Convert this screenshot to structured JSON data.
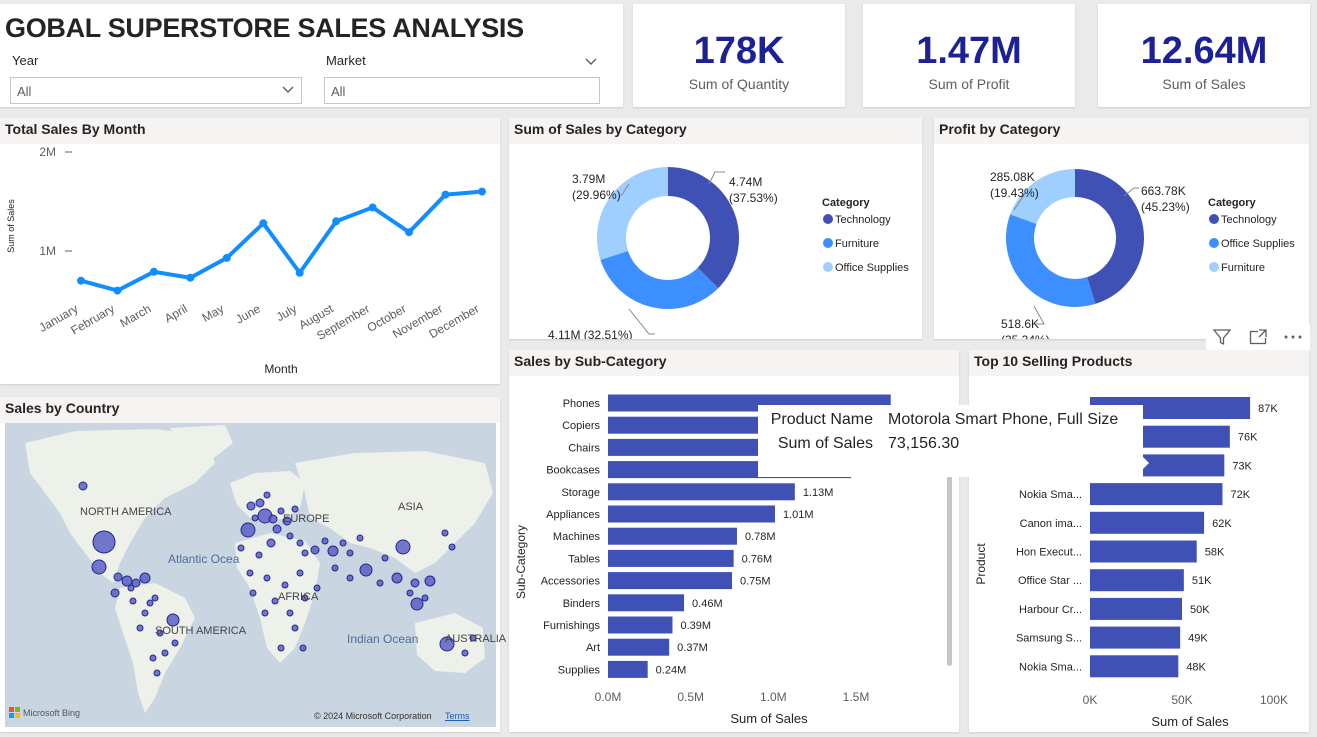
{
  "header": {
    "title": "GOBAL SUPERSTORE SALES ANALYSIS"
  },
  "filters": {
    "year": {
      "label": "Year",
      "value": "All"
    },
    "market": {
      "label": "Market",
      "value": "All"
    }
  },
  "kpis": [
    {
      "value": "178K",
      "label": "Sum of Quantity"
    },
    {
      "value": "1.47M",
      "label": "Sum of Profit"
    },
    {
      "value": "12.64M",
      "label": "Sum of Sales"
    }
  ],
  "colors": {
    "accent": "#1c2296",
    "line": "#118dff",
    "dark_blue": "#3f51b5",
    "mid_blue": "#3d8fff",
    "light_blue": "#9fcfff"
  },
  "visual_actions": [
    "filter-icon",
    "focus-mode-icon",
    "more-options-icon"
  ],
  "tooltip": {
    "product_label": "Product Name",
    "product_value": "Motorola Smart Phone, Full Size",
    "sales_label": "Sum of Sales",
    "sales_value": "73,156.30"
  },
  "map": {
    "title": "Sales by Country",
    "labels": {
      "na": "NORTH AMERICA",
      "eu": "EUROPE",
      "asia": "ASIA",
      "atlantic": "Atlantic Ocea",
      "africa": "AFRICA",
      "sa": "SOUTH AMERICA",
      "indian": "Indian Ocean",
      "aus": "AUSTRALIA"
    },
    "bing": "Microsoft Bing",
    "copyright": "© 2024 Microsoft Corporation",
    "terms": "Terms"
  },
  "chart_data": [
    {
      "type": "line",
      "title": "Total Sales By Month",
      "xlabel": "Month",
      "ylabel": "Sum of Sales",
      "categories": [
        "January",
        "February",
        "March",
        "April",
        "May",
        "June",
        "July",
        "August",
        "September",
        "October",
        "November",
        "December"
      ],
      "values": [
        0.7,
        0.6,
        0.79,
        0.73,
        0.93,
        1.28,
        0.78,
        1.3,
        1.44,
        1.19,
        1.57,
        1.6
      ],
      "yticks": [
        "1M",
        "2M"
      ],
      "ylim": [
        0,
        2.2
      ],
      "grid": false
    },
    {
      "type": "pie",
      "title": "Sum of Sales by Category",
      "legend_title": "Category",
      "legend_position": "right",
      "slices": [
        {
          "name": "Technology",
          "value": 4.74,
          "label": "4.74M",
          "percent": "(37.53%)"
        },
        {
          "name": "Furniture",
          "value": 4.11,
          "label": "4.11M (32.51%)",
          "percent": ""
        },
        {
          "name": "Office Supplies",
          "value": 3.79,
          "label": "3.79M",
          "percent": "(29.96%)"
        }
      ]
    },
    {
      "type": "pie",
      "title": "Profit by Category",
      "legend_title": "Category",
      "legend_position": "right",
      "slices": [
        {
          "name": "Technology",
          "value": 663.78,
          "label": "663.78K",
          "percent": "(45.23%)"
        },
        {
          "name": "Office Supplies",
          "value": 518.6,
          "label": "518.6K",
          "percent": "(35.34%)"
        },
        {
          "name": "Furniture",
          "value": 285.08,
          "label": "285.08K",
          "percent": "(19.43%)"
        }
      ]
    },
    {
      "type": "bar",
      "orientation": "horizontal",
      "title": "Sales by Sub-Category",
      "xlabel": "Sum of Sales",
      "ylabel": "Sub-Category",
      "categories": [
        "Phones",
        "Copiers",
        "Chairs",
        "Bookcases",
        "Storage",
        "Appliances",
        "Machines",
        "Tables",
        "Accessories",
        "Binders",
        "Furnishings",
        "Art",
        "Supplies"
      ],
      "values": [
        1.71,
        1.51,
        1.5,
        1.47,
        1.13,
        1.01,
        0.78,
        0.76,
        0.75,
        0.46,
        0.39,
        0.37,
        0.24
      ],
      "data_labels": [
        "",
        "",
        "",
        "",
        "1.13M",
        "1.01M",
        "0.78M",
        "0.76M",
        "0.75M",
        "0.46M",
        "0.39M",
        "0.37M",
        "0.24M"
      ],
      "xticks": [
        "0.0M",
        "0.5M",
        "1.0M",
        "1.5M"
      ],
      "xlim": [
        0,
        1.5
      ]
    },
    {
      "type": "bar",
      "orientation": "horizontal",
      "title": "Top 10 Selling Products",
      "xlabel": "Sum of Sales",
      "ylabel": "Product",
      "categories": [
        "",
        "",
        "",
        "Nokia Sma...",
        "Canon ima...",
        "Hon Execut...",
        "Office Star ...",
        "Harbour Cr...",
        "Samsung S...",
        "Nokia Sma..."
      ],
      "values": [
        87,
        76,
        73,
        72,
        62,
        58,
        51,
        50,
        49,
        48
      ],
      "data_labels": [
        "87K",
        "76K",
        "73K",
        "72K",
        "62K",
        "58K",
        "51K",
        "50K",
        "49K",
        "48K"
      ],
      "xticks": [
        "0K",
        "50K",
        "100K"
      ],
      "xlim": [
        0,
        100
      ]
    }
  ]
}
